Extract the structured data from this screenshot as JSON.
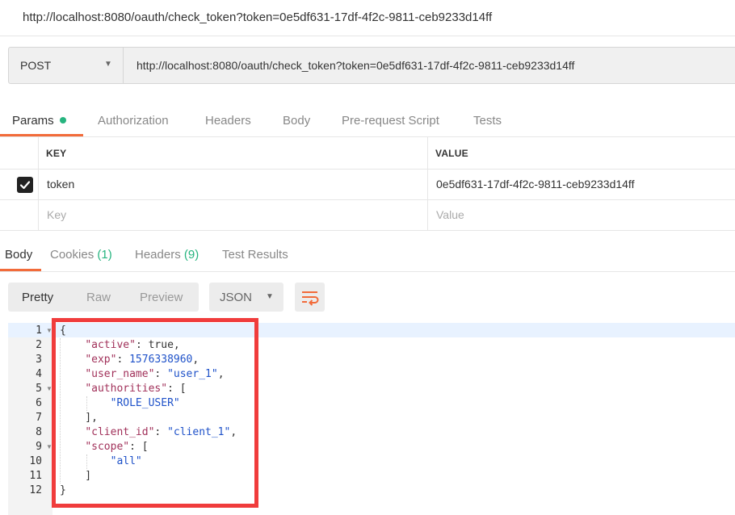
{
  "window": {
    "title": "http://localhost:8080/oauth/check_token?token=0e5df631-17df-4f2c-9811-ceb9233d14ff"
  },
  "request": {
    "method": "POST",
    "url": "http://localhost:8080/oauth/check_token?token=0e5df631-17df-4f2c-9811-ceb9233d14ff",
    "tabs": [
      "Params",
      "Authorization",
      "Headers",
      "Body",
      "Pre-request Script",
      "Tests"
    ],
    "active_tab": "Params",
    "params_indicator_color": "#26b47f"
  },
  "params_table": {
    "headers": {
      "key": "KEY",
      "value": "VALUE"
    },
    "rows": [
      {
        "checked": true,
        "key": "token",
        "value": "0e5df631-17df-4f2c-9811-ceb9233d14ff"
      }
    ],
    "placeholder": {
      "key": "Key",
      "value": "Value"
    }
  },
  "response": {
    "tabs": {
      "body": "Body",
      "cookies": "Cookies",
      "cookies_count": "(1)",
      "headers": "Headers",
      "headers_count": "(9)",
      "test_results": "Test Results"
    },
    "view_modes": [
      "Pretty",
      "Raw",
      "Preview"
    ],
    "active_view": "Pretty",
    "format": "JSON",
    "line_numbers": [
      "1",
      "2",
      "3",
      "4",
      "5",
      "6",
      "7",
      "8",
      "9",
      "10",
      "11",
      "12"
    ],
    "code": {
      "open_brace": "{",
      "active_key": "\"active\"",
      "active_value": "true",
      "exp_key": "\"exp\"",
      "exp_value": "1576338960",
      "user_name_key": "\"user_name\"",
      "user_name_value": "\"user_1\"",
      "authorities_key": "\"authorities\"",
      "authorities_item": "\"ROLE_USER\"",
      "client_id_key": "\"client_id\"",
      "client_id_value": "\"client_1\"",
      "scope_key": "\"scope\"",
      "scope_item": "\"all\"",
      "close_brace": "}"
    }
  },
  "colors": {
    "accent": "#f26b3a",
    "success": "#26b47f",
    "annotation_box": "#f03c3c",
    "json_key": "#a1315a",
    "json_value": "#1f52c9"
  }
}
